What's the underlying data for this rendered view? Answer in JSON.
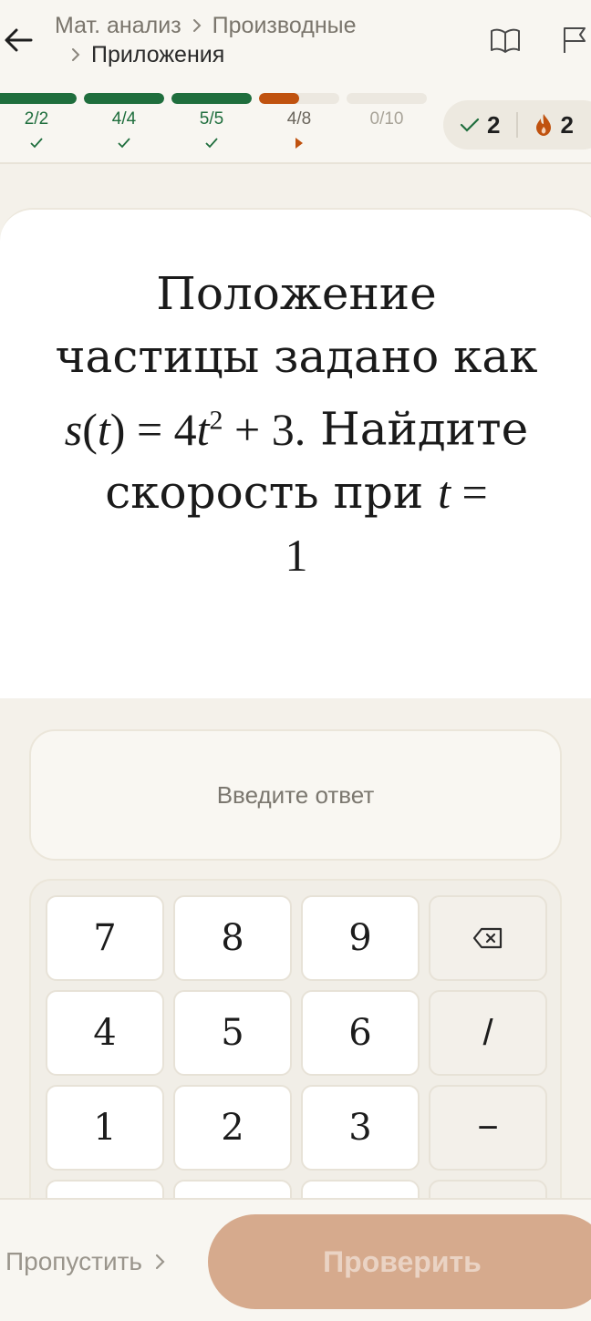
{
  "header": {
    "breadcrumb": {
      "course": "Мат. анализ",
      "topic": "Производные",
      "lesson": "Приложения"
    }
  },
  "progress": {
    "segments": [
      {
        "label": "2/2",
        "done": 2,
        "total": 2,
        "state": "complete"
      },
      {
        "label": "4/4",
        "done": 4,
        "total": 4,
        "state": "complete"
      },
      {
        "label": "5/5",
        "done": 5,
        "total": 5,
        "state": "complete"
      },
      {
        "label": "4/8",
        "done": 4,
        "total": 8,
        "state": "current"
      },
      {
        "label": "0/10",
        "done": 0,
        "total": 10,
        "state": "upcoming"
      }
    ],
    "colors": {
      "complete": "#1f6e3d",
      "current": "#c0520f",
      "track": "#ece8e0"
    }
  },
  "stats": {
    "correct": "2",
    "streak": "2",
    "correct_color": "#1f6e3d",
    "streak_color": "#c0520f"
  },
  "question": {
    "part1": "Положение частицы задано как ",
    "func_name": "s",
    "func_arg": "t",
    "equals": "=",
    "coef": "4",
    "var": "t",
    "exponent": "2",
    "plus": "+",
    "constant": "3",
    "period": ".",
    "part2": " Найдите скорость при ",
    "at_var": "t",
    "at_equals": "=",
    "at_value": "1"
  },
  "answer": {
    "placeholder": "Введите ответ",
    "value": ""
  },
  "keypad": {
    "keys": [
      "7",
      "8",
      "9",
      "4",
      "5",
      "6",
      "/",
      "1",
      "2",
      "3",
      "−"
    ]
  },
  "footer": {
    "skip_label": "Пропустить",
    "check_label": "Проверить",
    "check_color": "#d6aa8d"
  }
}
